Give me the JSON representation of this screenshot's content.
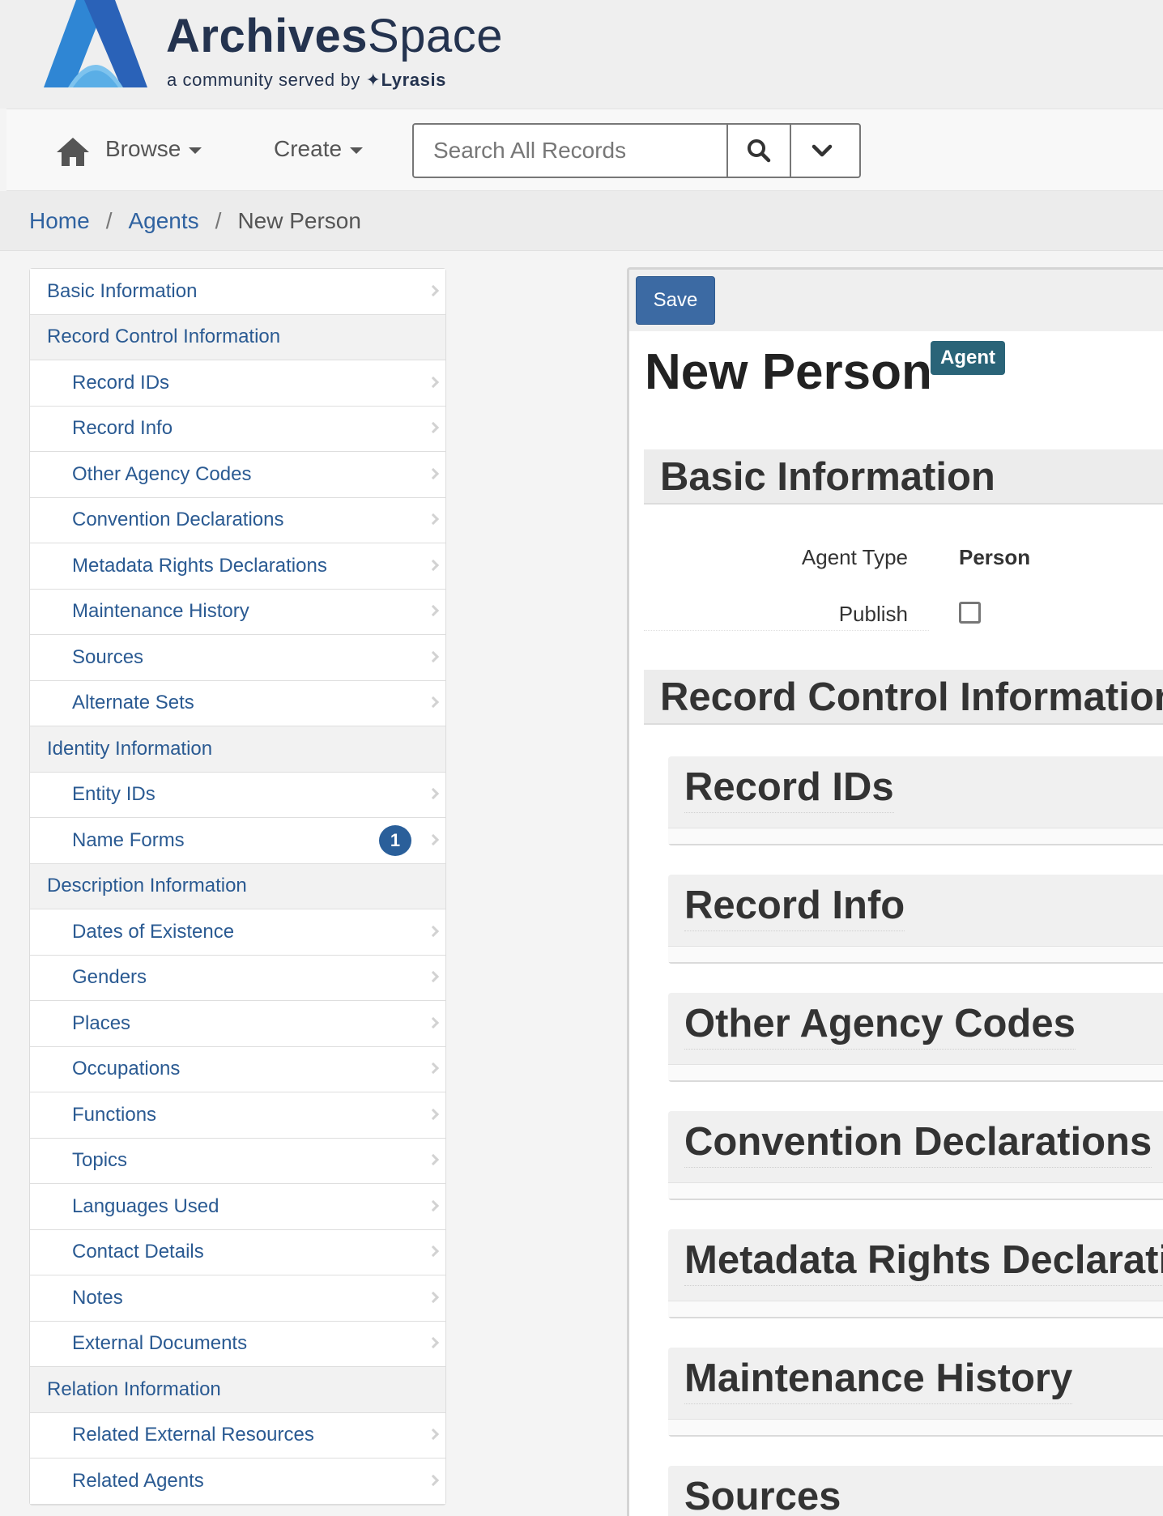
{
  "brand": {
    "name_bold": "Archives",
    "name_light": "Space",
    "tagline_prefix": "a community served by",
    "tagline_org": "Lyrasis",
    "tagline_mark": "✦"
  },
  "navbar": {
    "browse_label": "Browse",
    "create_label": "Create",
    "search_placeholder": "Search All Records"
  },
  "breadcrumb": {
    "home": "Home",
    "agents": "Agents",
    "current": "New Person",
    "separator": "/"
  },
  "sidebar": {
    "basic_information": "Basic Information",
    "record_control": {
      "label": "Record Control Information",
      "items": [
        "Record IDs",
        "Record Info",
        "Other Agency Codes",
        "Convention Declarations",
        "Metadata Rights Declarations",
        "Maintenance History",
        "Sources",
        "Alternate Sets"
      ]
    },
    "identity": {
      "label": "Identity Information",
      "items": [
        "Entity IDs",
        "Name Forms"
      ],
      "name_forms_count": "1"
    },
    "description": {
      "label": "Description Information",
      "items": [
        "Dates of Existence",
        "Genders",
        "Places",
        "Occupations",
        "Functions",
        "Topics",
        "Languages Used",
        "Contact Details",
        "Notes",
        "External Documents"
      ]
    },
    "relation": {
      "label": "Relation Information",
      "items": [
        "Related External Resources",
        "Related Agents"
      ]
    }
  },
  "main": {
    "save_label": "Save",
    "title": "New Person",
    "title_badge": "Agent",
    "basic_section": "Basic Information",
    "agent_type_label": "Agent Type",
    "agent_type_value": "Person",
    "publish_label": "Publish",
    "record_control_section": "Record Control Information",
    "subpanels": [
      "Record IDs",
      "Record Info",
      "Other Agency Codes",
      "Convention Declarations",
      "Metadata Rights Declarations",
      "Maintenance History",
      "Sources"
    ]
  },
  "colors": {
    "link": "#2f62a0",
    "primary_button": "#3c6aa3",
    "badge": "#2a5f9a",
    "agent_badge": "#2a6478",
    "brand_text": "#24334f"
  }
}
